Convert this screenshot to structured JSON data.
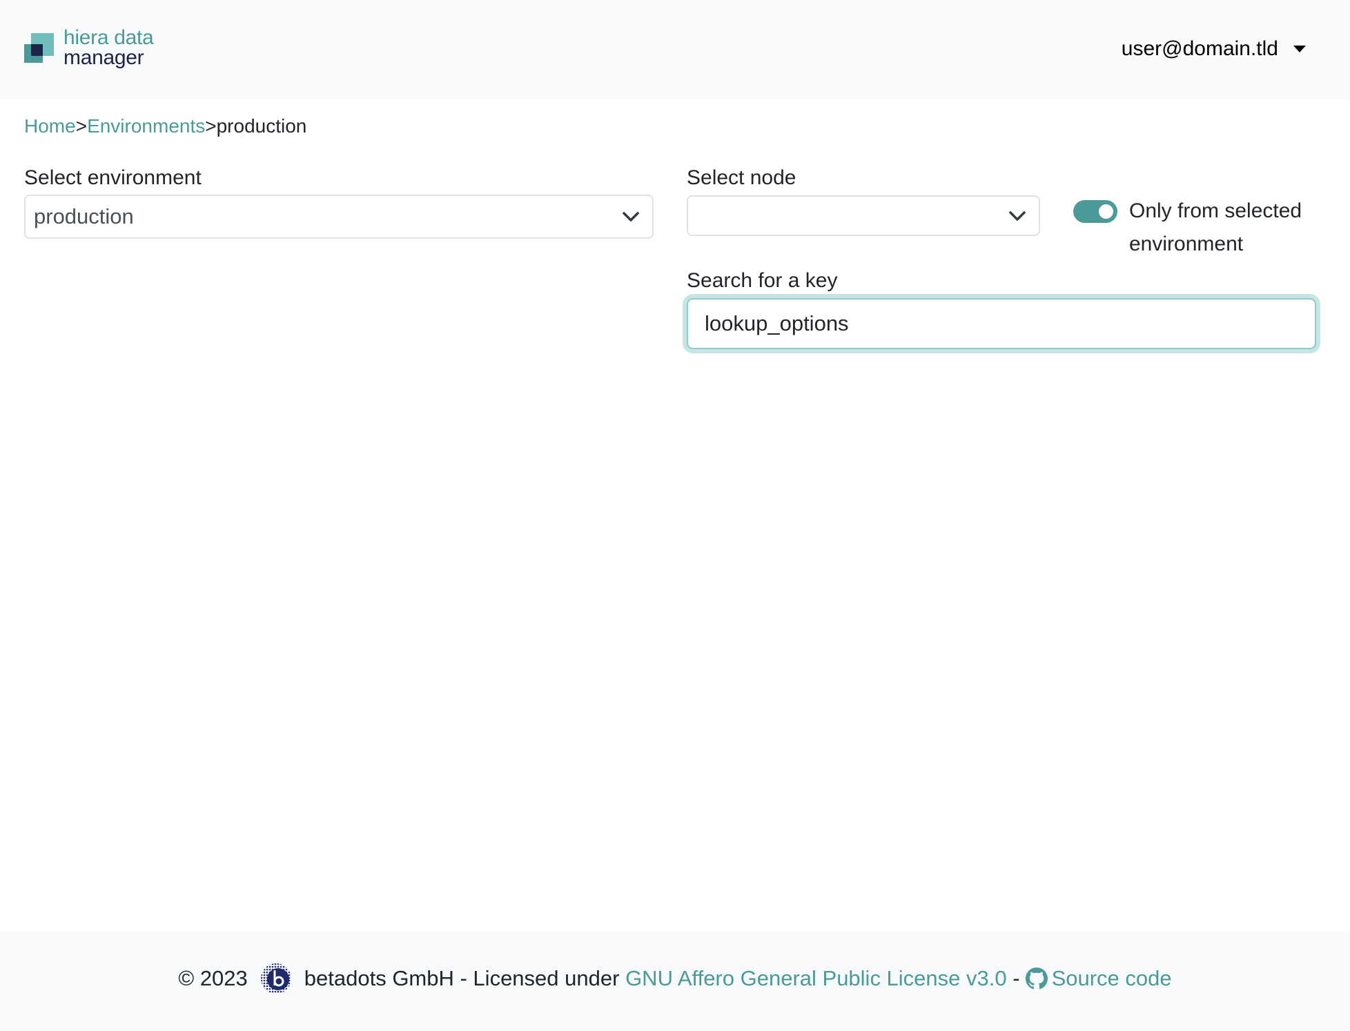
{
  "header": {
    "logo": {
      "line1": "hiera data",
      "line2": "manager"
    },
    "user_menu": {
      "label": "user@domain.tld",
      "icon": "caret-down-icon"
    }
  },
  "breadcrumb": {
    "items": [
      {
        "label": "Home",
        "link": true
      },
      {
        "label": "Environments",
        "link": true
      },
      {
        "label": "production",
        "link": false
      }
    ],
    "separator": ">"
  },
  "form": {
    "environment": {
      "label": "Select environment",
      "value": "production"
    },
    "node": {
      "label": "Select node",
      "value": ""
    },
    "toggle": {
      "label": "Only from selected environment",
      "checked": true
    },
    "search": {
      "label": "Search for a key",
      "value": "lookup_options",
      "placeholder": ""
    }
  },
  "footer": {
    "copyright": "© 2023",
    "company": "betadots GmbH - Licensed under",
    "license_link": "GNU Affero General Public License v3.0",
    "dash": "-",
    "source_link": "Source code"
  },
  "colors": {
    "accent": "#4a9a99",
    "navy": "#1e2447",
    "header_bg": "#f8f9fa",
    "focus_ring": "#c7e5e5"
  }
}
